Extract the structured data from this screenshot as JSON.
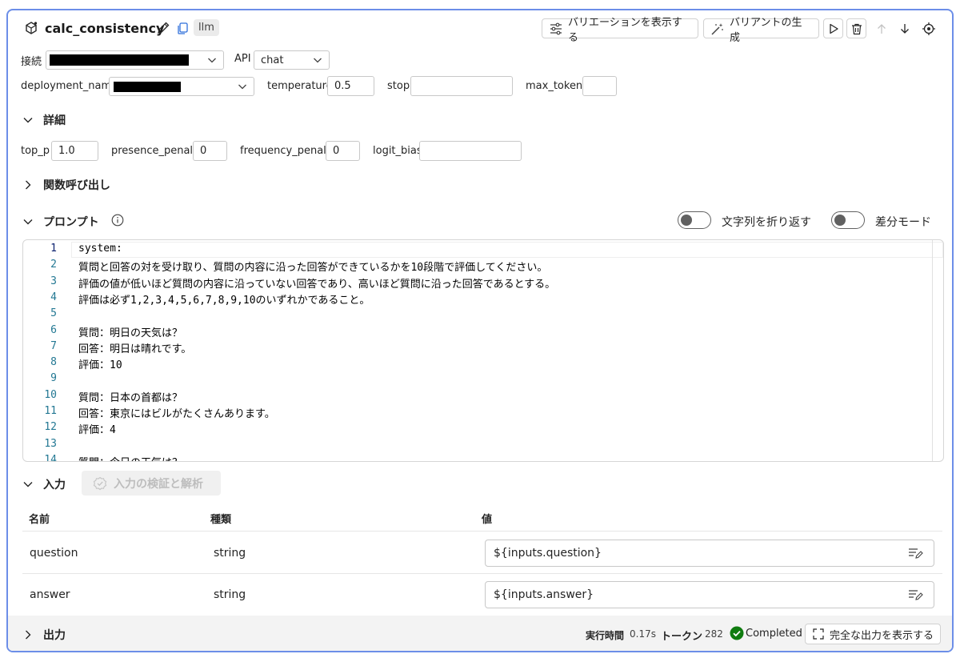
{
  "header": {
    "node_name": "calc_consistency",
    "type_badge": "llm",
    "show_variations_label": "バリエーションを表示する",
    "generate_variants_label": "バリアントの生成"
  },
  "connection": {
    "connection_label": "接続",
    "api_label": "API",
    "api_value": "chat",
    "deployment_label": "deployment_name",
    "temperature_label": "temperature",
    "temperature_value": "0.5",
    "stop_label": "stop",
    "stop_value": "",
    "max_tokens_label": "max_tokens",
    "max_tokens_value": ""
  },
  "advanced": {
    "section_label": "詳細",
    "top_p_label": "top_p",
    "top_p_value": "1.0",
    "presence_penalty_label": "presence_penalty",
    "presence_penalty_value": "0",
    "frequency_penalty_label": "frequency_penalty",
    "frequency_penalty_value": "0",
    "logit_bias_label": "logit_bias",
    "logit_bias_value": ""
  },
  "function_call": {
    "section_label": "関数呼び出し"
  },
  "prompt": {
    "section_label": "プロンプト",
    "wrap_label": "文字列を折り返す",
    "wrap_enabled": false,
    "diff_label": "差分モード",
    "diff_enabled": false,
    "lines": [
      {
        "no": "1",
        "text": "system:"
      },
      {
        "no": "2",
        "text": "質問と回答の対を受け取り、質問の内容に沿った回答ができているかを10段階で評価してください。"
      },
      {
        "no": "3",
        "text": "評価の値が低いほど質問の内容に沿っていない回答であり、高いほど質問に沿った回答であるとする。"
      },
      {
        "no": "4",
        "text": "評価は必ず1,2,3,4,5,6,7,8,9,10のいずれかであること。"
      },
      {
        "no": "5",
        "text": ""
      },
      {
        "no": "6",
        "text": "質問：明日の天気は？"
      },
      {
        "no": "7",
        "text": "回答：明日は晴れです。"
      },
      {
        "no": "8",
        "text": "評価：10"
      },
      {
        "no": "9",
        "text": ""
      },
      {
        "no": "10",
        "text": "質問：日本の首都は？"
      },
      {
        "no": "11",
        "text": "回答：東京にはビルがたくさんあります。"
      },
      {
        "no": "12",
        "text": "評価：4"
      },
      {
        "no": "13",
        "text": ""
      },
      {
        "no": "14",
        "text": "質問：今日の天気は？"
      }
    ]
  },
  "inputs": {
    "section_label": "入力",
    "validate_label": "入力の検証と解析",
    "col_name": "名前",
    "col_type": "種類",
    "col_value": "値",
    "rows": [
      {
        "name": "question",
        "type": "string",
        "value": "${inputs.question}"
      },
      {
        "name": "answer",
        "type": "string",
        "value": "${inputs.answer}"
      }
    ]
  },
  "outputs": {
    "section_label": "出力",
    "exec_time_label": "実行時間",
    "exec_time_value": "0.17s",
    "tokens_label": "トークン",
    "tokens_value": "282",
    "status": "Completed",
    "status_color": "#107c10",
    "full_output_label": "完全な出力を表示する"
  },
  "colors": {
    "frame_border": "#6c8ee8",
    "line_number": "#237893"
  }
}
